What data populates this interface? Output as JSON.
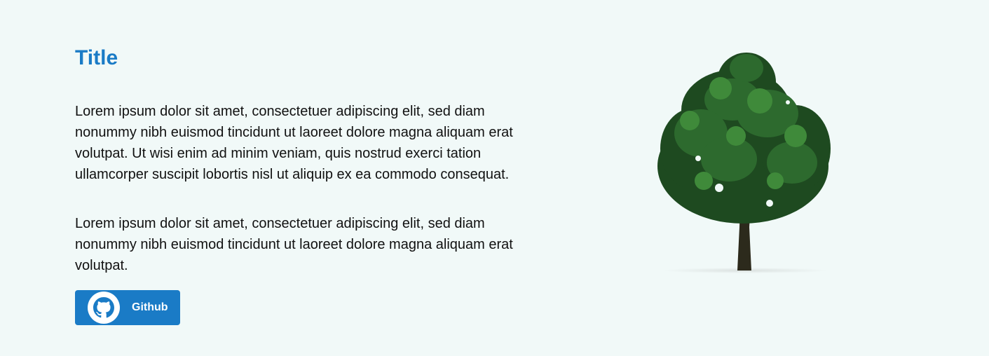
{
  "main": {
    "title": "Title",
    "paragraphs": [
      "Lorem ipsum dolor sit amet, consectetuer adipiscing elit, sed diam nonummy nibh euismod tincidunt ut laoreet dolore magna aliquam erat volutpat. Ut wisi enim ad minim veniam, quis nostrud exerci tation ullamcorper suscipit lobortis nisl ut aliquip ex ea commodo consequat.",
      "Lorem ipsum dolor sit amet, consectetuer adipiscing elit, sed diam nonummy nibh euismod tincidunt ut laoreet dolore magna aliquam erat volutpat."
    ],
    "github_button": {
      "label": "Github",
      "icon": "github-icon"
    }
  },
  "image": {
    "subject": "tree-illustration"
  },
  "colors": {
    "background": "#f1f9f8",
    "accent": "#1a7bc6",
    "text": "#111111"
  }
}
